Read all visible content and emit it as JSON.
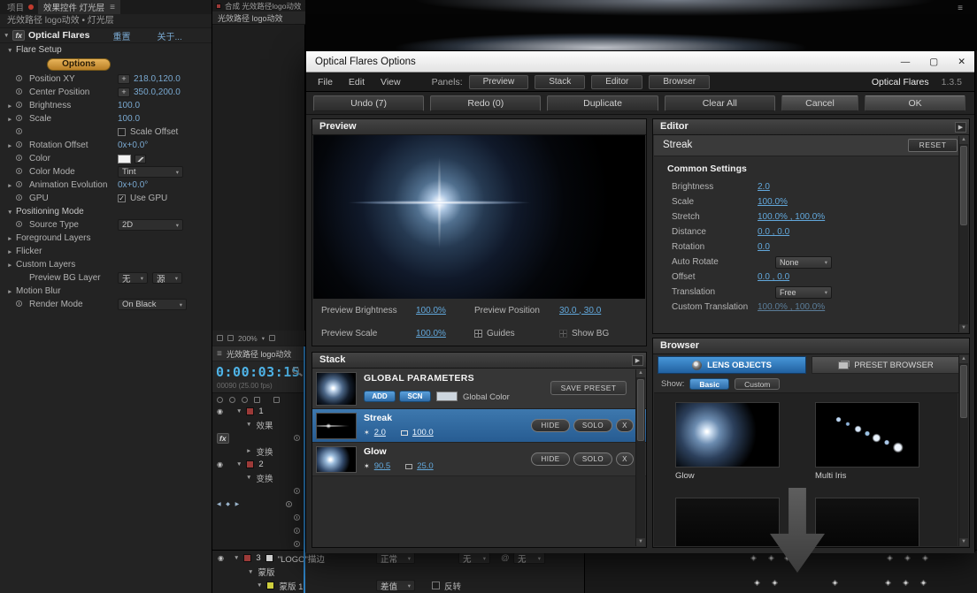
{
  "colors": {
    "of_accent_blue": "#2e82c4",
    "of_value_blue": "#62a8dc",
    "ae_value_blue": "#79a8d0",
    "timecode_blue": "#4fb4e8",
    "layer_label_red": "#9c3a38",
    "mask_label_yellow": "#cfcf3e",
    "options_button_orange": "#d89a3c"
  },
  "icons": {
    "chevron_down": "▾",
    "expand_right": "►",
    "expand_down": "▼",
    "hamburger": "≡",
    "plus": "+",
    "keyframe_nav": "◀ ◆ ▶",
    "check": "✓",
    "star": "✶",
    "link_at": "@",
    "scroll_up": "▲",
    "scroll_down": "▼",
    "panel_expand": "▶"
  },
  "effect_controls": {
    "tab_project": "项目",
    "tab_active": "效果控件 灯光层",
    "comp_title": "光效路径 logo动效 • 灯光层",
    "fx_badge": "fx",
    "effect_name": "Optical Flares",
    "reset_link": "重置",
    "about_link": "关于...",
    "flare_setup_label": "Flare Setup",
    "options_button": "Options",
    "rows": [
      {
        "label": "Position XY",
        "value": "218.0,120.0"
      },
      {
        "label": "Center Position",
        "value": "350.0,200.0"
      },
      {
        "label": "Brightness",
        "value": "100.0"
      },
      {
        "label": "Scale",
        "value": "100.0"
      },
      {
        "label": "",
        "value": "Scale Offset"
      },
      {
        "label": "Rotation Offset",
        "value": "0x+0.0°"
      },
      {
        "label": "Color",
        "value": ""
      },
      {
        "label": "Color Mode",
        "value": "Tint"
      },
      {
        "label": "Animation Evolution",
        "value": "0x+0.0°"
      },
      {
        "label": "GPU",
        "value": "Use GPU"
      }
    ],
    "positioning_mode_label": "Positioning Mode",
    "source_type_label": "Source Type",
    "source_type_value": "2D",
    "foreground_layers_label": "Foreground Layers",
    "flicker_label": "Flicker",
    "custom_layers_label": "Custom Layers",
    "preview_bg_label": "Preview BG Layer",
    "preview_bg_value1": "无",
    "preview_bg_value2": "源",
    "motion_blur_label": "Motion Blur",
    "render_mode_label": "Render Mode",
    "render_mode_value": "On Black"
  },
  "viewer": {
    "comp_tab": "合成 光效路径logo动效",
    "comp_subtab": "光效路径 logo动效",
    "zoom_level": "200%"
  },
  "timeline": {
    "panel_tab": "光效路径 logo动效",
    "timecode": "0:00:03:15",
    "frame_info": "00090 (25.00 fps)",
    "layer1_num": "1",
    "layer2_num": "2",
    "layer3_num": "3",
    "effects_label": "效果",
    "fx_badge": "fx",
    "transform_label_1": "变换",
    "transform_label_2": "变换",
    "layer3_name": "\"LOGO\"描边",
    "layer3_mode": "正常",
    "layer3_trkmat": "无",
    "layer3_parent": "无",
    "mask_group_label": "蒙版",
    "mask_name": "蒙版 1",
    "mask_mode": "差值",
    "mask_invert_label": "反转"
  },
  "dialog": {
    "title": "Optical Flares Options",
    "win_minimize": "—",
    "win_maximize": "▢",
    "win_close": "✕",
    "menu_file": "File",
    "menu_edit": "Edit",
    "menu_view": "View",
    "panels_label": "Panels:",
    "panel_preview": "Preview",
    "panel_stack": "Stack",
    "panel_editor": "Editor",
    "panel_browser": "Browser",
    "brand": "Optical Flares",
    "version": "1.3.5",
    "undo_button": "Undo (7)",
    "redo_button": "Redo (0)",
    "duplicate_button": "Duplicate",
    "clear_all_button": "Clear All",
    "cancel_button": "Cancel",
    "ok_button": "OK",
    "preview": {
      "title": "Preview",
      "brightness_label": "Preview Brightness",
      "brightness_value": "100.0%",
      "scale_label": "Preview Scale",
      "scale_value": "100.0%",
      "position_label": "Preview Position",
      "position_value": "30.0 , 30.0",
      "guides_label": "Guides",
      "show_bg_label": "Show BG"
    },
    "editor": {
      "title": "Editor",
      "selected_object": "Streak",
      "reset_button": "RESET",
      "section_title": "Common Settings",
      "params": [
        {
          "label": "Brightness",
          "value": "2.0"
        },
        {
          "label": "Scale",
          "value": "100.0%"
        },
        {
          "label": "Stretch",
          "value": "100.0% , 100.0%"
        },
        {
          "label": "Distance",
          "value": "0.0 , 0.0"
        },
        {
          "label": "Rotation",
          "value": "0.0"
        },
        {
          "label": "Auto Rotate",
          "value": "None"
        },
        {
          "label": "Offset",
          "value": "0.0 , 0.0"
        },
        {
          "label": "Translation",
          "value": "Free"
        },
        {
          "label": "Custom Translation",
          "value": "100.0% , 100.0%"
        }
      ]
    },
    "stack": {
      "title": "Stack",
      "global_title": "GLOBAL PARAMETERS",
      "add_button": "ADD",
      "scn_button": "SCN",
      "global_color_label": "Global Color",
      "save_preset_button": "SAVE PRESET",
      "hide_button": "HIDE",
      "solo_button": "SOLO",
      "delete_button": "X",
      "layers": [
        {
          "name": "Streak",
          "brightness": "2.0",
          "scale": "100.0"
        },
        {
          "name": "Glow",
          "brightness": "90.5",
          "scale": "25.0"
        }
      ]
    },
    "browser": {
      "title": "Browser",
      "lens_objects_tab": "LENS OBJECTS",
      "preset_browser_tab": "PRESET BROWSER",
      "show_label": "Show:",
      "basic_filter": "Basic",
      "custom_filter": "Custom",
      "items": [
        {
          "name": "Glow"
        },
        {
          "name": "Multi Iris"
        }
      ]
    }
  }
}
